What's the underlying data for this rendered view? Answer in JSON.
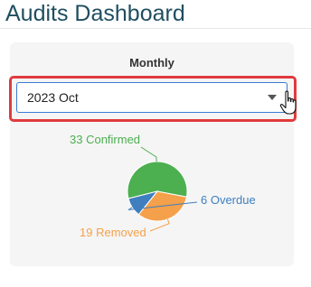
{
  "header": {
    "title": "Audits Dashboard"
  },
  "card": {
    "title": "Monthly",
    "month_select": {
      "selected": "2023 Oct"
    }
  },
  "chart_data": {
    "type": "pie",
    "categories": [
      "Confirmed",
      "Removed",
      "Overdue"
    ],
    "values": [
      33,
      19,
      6
    ],
    "labels": [
      "33 Confirmed",
      "19 Removed",
      "6 Overdue"
    ],
    "colors": [
      "#4caf50",
      "#f5a04a",
      "#3f7fbf"
    ]
  },
  "theme": {
    "title_color": "#1f4e60",
    "highlight_color": "#e03a3e",
    "select_border": "#3b7bd4"
  },
  "icons": {
    "caret": "chevron-down-icon",
    "cursor": "hand-pointer-icon"
  }
}
